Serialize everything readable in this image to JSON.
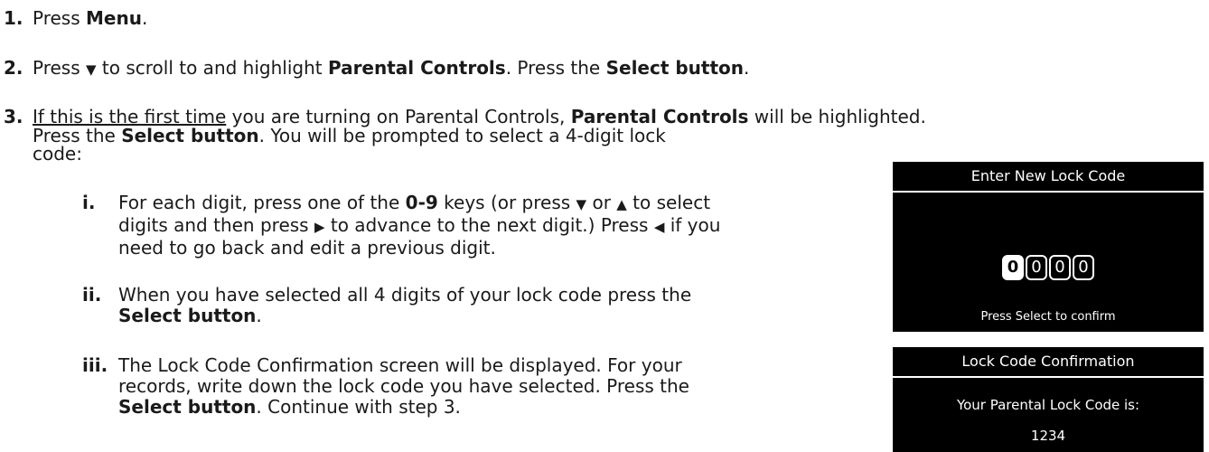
{
  "steps": {
    "s1": {
      "num": "1.",
      "a": "Press ",
      "b": "Menu",
      "c": "."
    },
    "s2": {
      "num": "2.",
      "a": "Press ",
      "tri": "▼",
      "b": " to scroll to and highlight ",
      "c": "Parental Controls",
      "d": ". Press the ",
      "e": "Select button",
      "f": "."
    },
    "s3": {
      "num": "3.",
      "u": "If this is the first time",
      "a": " you are turning on Parental Controls, ",
      "b": "Parental Controls",
      "c": " will be highlighted.",
      "d": "Press the ",
      "e": "Select button",
      "f": ". You will be prompted to select a 4-digit lock",
      "g": "code:"
    }
  },
  "substeps": {
    "i": {
      "num": "i.",
      "l1a": "For each digit, press one of the ",
      "l1b": "0",
      "l1c": "-",
      "l1d": "9",
      "l1e": " keys (or press ",
      "t_down": "▼",
      "l1f": " or ",
      "t_up": "▲",
      "l1g": " to select",
      "l2a": "digits and then press ",
      "t_right": "▶",
      "l2b": " to advance to the next digit.) Press ",
      "t_left": "◀",
      "l2c": " if you",
      "l3": "need to go back and edit a previous digit."
    },
    "ii": {
      "num": "ii.",
      "l1": "When you have selected all 4 digits of your lock code press the",
      "l2b": "Select button",
      "l2c": "."
    },
    "iii": {
      "num": "iii.",
      "l1": "The Lock Code Confirmation screen will be displayed. For your",
      "l2": "records, write down the lock code you have selected. Press the",
      "l3b": "Select button",
      "l3c": ". Continue with step 3."
    }
  },
  "screen1": {
    "title": "Enter New Lock Code",
    "digits": [
      "0",
      "0",
      "0",
      "0"
    ],
    "footer": "Press Select to confirm"
  },
  "screen2": {
    "title": "Lock Code Confirmation",
    "line1": "Your Parental Lock Code is:",
    "code": "1234"
  }
}
